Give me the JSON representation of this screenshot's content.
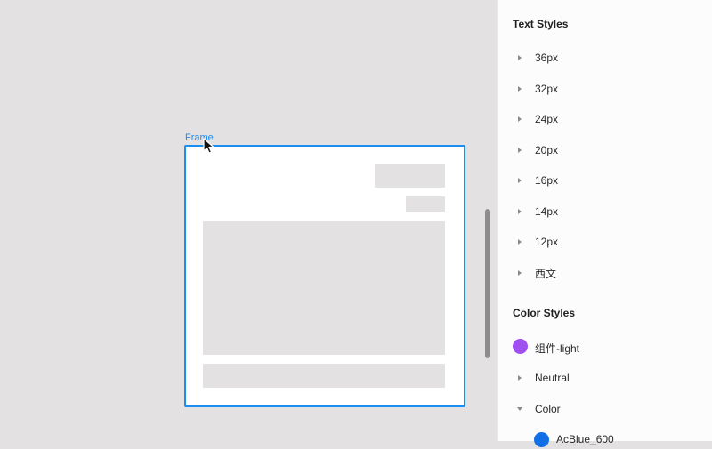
{
  "canvas": {
    "frame_label": "Frame"
  },
  "panel": {
    "text_styles": {
      "title": "Text Styles",
      "items": [
        "36px",
        "32px",
        "24px",
        "20px",
        "16px",
        "14px",
        "12px",
        "西文"
      ]
    },
    "color_styles": {
      "title": "Color Styles",
      "swatch_item": {
        "label": "组件-light",
        "color": "#a050ee"
      },
      "groups": [
        {
          "label": "Neutral",
          "expanded": false
        },
        {
          "label": "Color",
          "expanded": true
        }
      ],
      "child_item": {
        "label": "AcBlue_600",
        "color": "#1270e6"
      }
    }
  },
  "colors": {
    "selection": "#1b8ef2",
    "canvas_bg": "#e3e1e2",
    "panel_bg": "#fdfcfd"
  }
}
